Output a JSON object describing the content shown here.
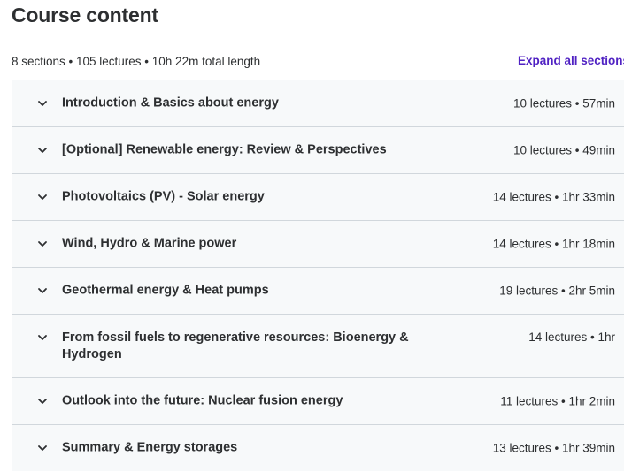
{
  "header": {
    "title": "Course content",
    "summary": "8 sections • 105 lectures • 10h 22m total length",
    "expand_label": "Expand all sections"
  },
  "sections": [
    {
      "title": "Introduction & Basics about energy",
      "meta": "10 lectures • 57min"
    },
    {
      "title": "[Optional] Renewable energy: Review & Perspectives",
      "meta": "10 lectures • 49min"
    },
    {
      "title": "Photovoltaics (PV) - Solar energy",
      "meta": "14 lectures • 1hr 33min"
    },
    {
      "title": "Wind, Hydro & Marine power",
      "meta": "14 lectures • 1hr 18min"
    },
    {
      "title": "Geothermal energy & Heat pumps",
      "meta": "19 lectures • 2hr 5min"
    },
    {
      "title": "From fossil fuels to regenerative resources: Bioenergy & Hydrogen",
      "meta": "14 lectures • 1hr"
    },
    {
      "title": "Outlook into the future: Nuclear fusion energy",
      "meta": "11 lectures • 1hr 2min"
    },
    {
      "title": "Summary & Energy storages",
      "meta": "13 lectures • 1hr 39min"
    }
  ],
  "colors": {
    "accent": "#5022c3",
    "text": "#2d2f31",
    "section_bg": "#f7f9fa",
    "border": "#d1d7dc"
  },
  "icons": {
    "section_toggle": "chevron-down-icon"
  }
}
